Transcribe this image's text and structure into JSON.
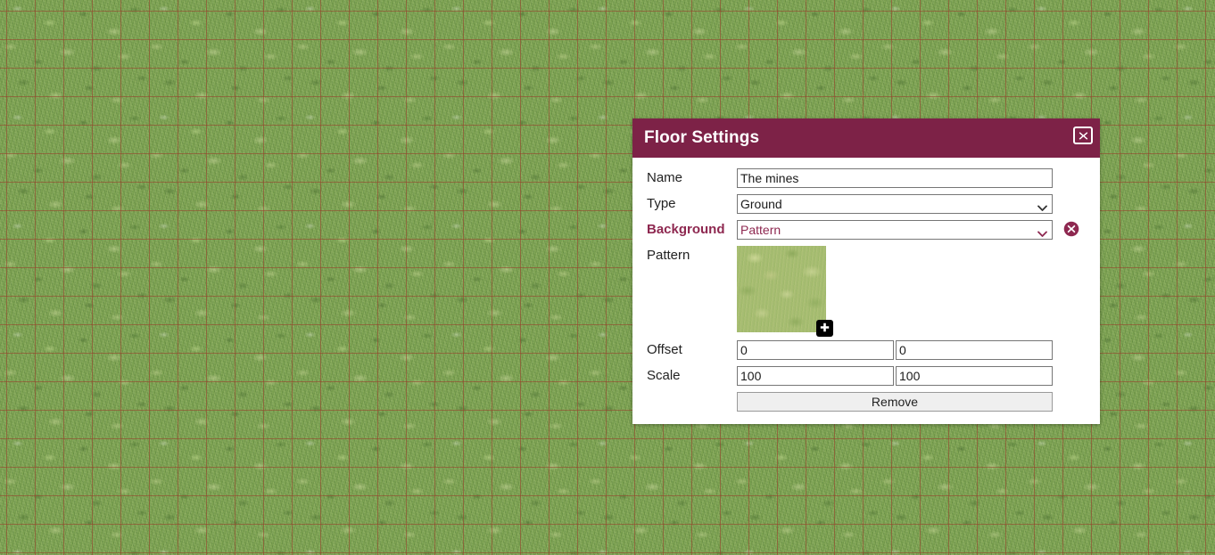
{
  "canvas": {
    "name": "map-canvas",
    "grass_color": "#7ba055",
    "grid_line_color": "#96462d",
    "grid_spacing_px": 32
  },
  "dialog": {
    "title": "Floor Settings",
    "close_icon": "close-x-icon",
    "accent_color": "#7d2247",
    "label_accent_color": "#8e2850",
    "fields": {
      "name": {
        "label": "Name",
        "value": "The mines",
        "placeholder": ""
      },
      "type": {
        "label": "Type",
        "value": "Ground",
        "options": [
          "Ground"
        ],
        "arrow_icon": "chevron-down-icon"
      },
      "background": {
        "label": "Background",
        "value": "Pattern",
        "options": [
          "Pattern"
        ],
        "arrow_icon": "chevron-down-icon",
        "delete_icon": "circle-x-delete-icon"
      },
      "pattern": {
        "label": "Pattern",
        "add_icon": "plus-icon",
        "thumbnail_color": "#a5bb72"
      },
      "offset": {
        "label": "Offset",
        "x": "0",
        "y": "0"
      },
      "scale": {
        "label": "Scale",
        "x": "100",
        "y": "100"
      }
    },
    "remove_label": "Remove"
  }
}
